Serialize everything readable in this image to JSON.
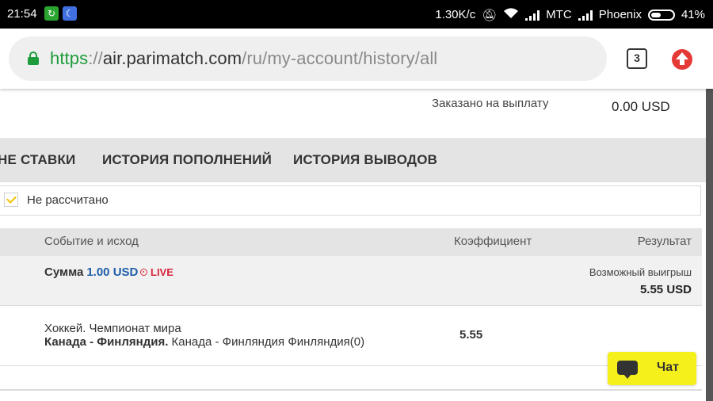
{
  "statusbar": {
    "time": "21:54",
    "app_icon_1": "refresh-app-icon",
    "app_icon_2": "moon-app-icon",
    "speed": "1.30K/c",
    "carrier1": "МТС",
    "carrier2": "Phoenix",
    "battery": "41%"
  },
  "browser": {
    "url_scheme": "https",
    "url_sep": "://",
    "url_host": "air.parimatch.com",
    "url_path": "/ru/my-account/history/all",
    "tab_count": "3"
  },
  "account": {
    "payout_label": "Заказано на выплату",
    "payout_value": "0.00 USD"
  },
  "tabs": [
    {
      "label": "НЕ СТАВКИ"
    },
    {
      "label": "ИСТОРИЯ ПОПОЛНЕНИЙ"
    },
    {
      "label": "ИСТОРИЯ ВЫВОДОВ"
    }
  ],
  "filter": {
    "label": "Не рассчитано",
    "checked": true
  },
  "table": {
    "columns": [
      "Событие и исход",
      "Коэффициент",
      "Результат"
    ]
  },
  "bet": {
    "stake_label": "Сумма",
    "stake_amount": "1.00 USD",
    "live_label": "LIVE",
    "possible_win_label": "Возможный выигрыш",
    "possible_win_value": "5.55 USD"
  },
  "event": {
    "sport": "Хоккей. Чемпионат мира",
    "match_bold": "Канада - Финляндия.",
    "selection": " Канада - Финляндия Финляндия(0)",
    "odds": "5.55"
  },
  "chat": {
    "label": "Чат"
  },
  "colors": {
    "chat_bg": "#f5ef1c",
    "live": "#d7263d",
    "amount": "#1f5ea8",
    "secure": "#1e9b3b"
  }
}
